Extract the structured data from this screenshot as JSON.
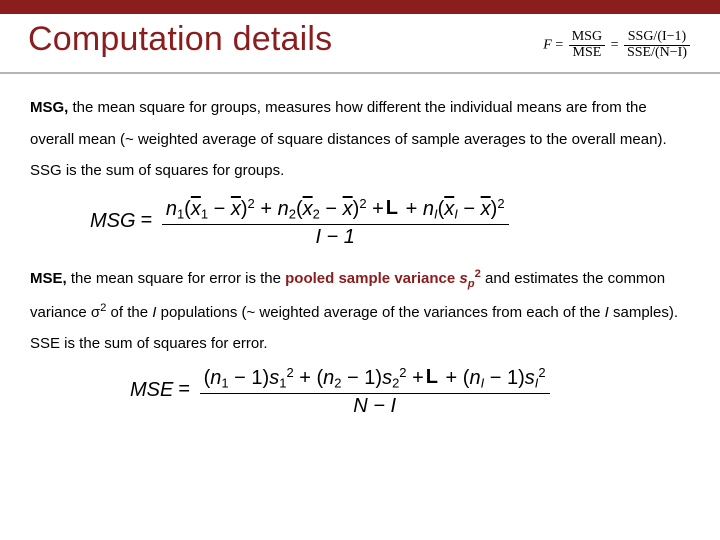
{
  "title": "Computation details",
  "header_formula": {
    "lhs": "F",
    "eq": "=",
    "frac1_num": "MSG",
    "frac1_den": "MSE",
    "frac2_num": "SSG/(I−1)",
    "frac2_den": "SSE/(N−I)"
  },
  "para1": {
    "lead": "MSG,",
    "text1": " the mean square for groups, measures how different the individual means are from the overall mean (~ weighted average of square distances of sample averages to the overall mean). SSG is the sum of squares for groups."
  },
  "eq1": {
    "lhs": "MSG",
    "den": "I − 1"
  },
  "para2": {
    "lead": "MSE,",
    "text1": " the mean square for error is the ",
    "pooled": "pooled sample variance ",
    "sp": "s",
    "sp_sub": "p",
    "sp_sup": "2",
    "text2": " and estimates the common variance σ",
    "sigma_sup": "2",
    "text3": " of the ",
    "I1": "I",
    "text4": " populations (~ weighted average of the variances from each of the ",
    "I2": "I",
    "text5": " samples). SSE is the sum of squares for error."
  },
  "eq2": {
    "lhs": "MSE",
    "den": "N − I"
  }
}
